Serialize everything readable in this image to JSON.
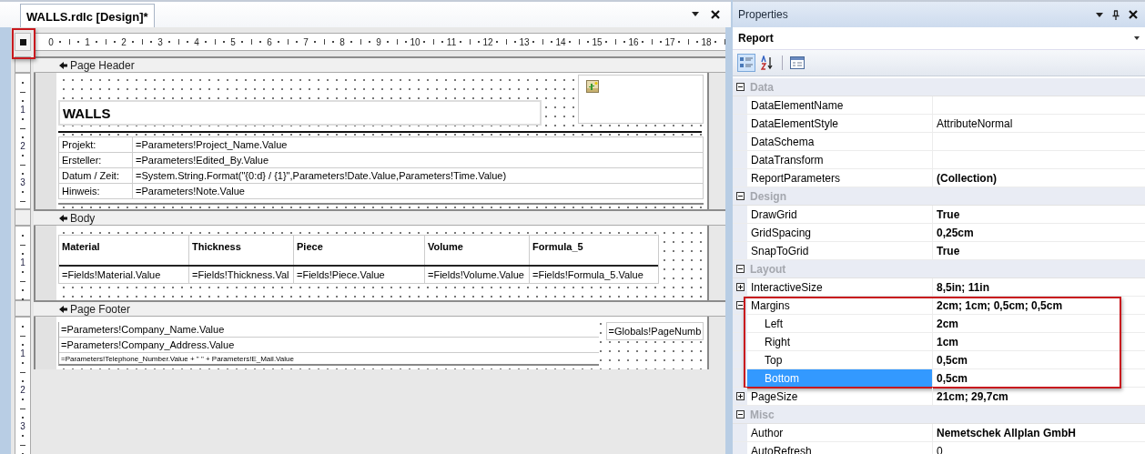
{
  "designer": {
    "tab": {
      "title": "WALLS.rdlc [Design]*",
      "selected": true
    },
    "ruler": {
      "corner_highlighted": true,
      "labels": [
        "0",
        "1",
        "2",
        "3",
        "4",
        "5",
        "6",
        "7",
        "8",
        "9",
        "10",
        "11",
        "12",
        "13",
        "14",
        "15",
        "16",
        "17",
        "18"
      ]
    },
    "sections": [
      {
        "kind": "header",
        "title": "Page Header",
        "ruler_labels": [
          "1",
          "2",
          "3"
        ],
        "title_box": "WALLS",
        "fields": [
          {
            "label": "Projekt:",
            "value": "=Parameters!Project_Name.Value"
          },
          {
            "label": "Ersteller:",
            "value": "=Parameters!Edited_By.Value"
          },
          {
            "label": "Datum / Zeit:",
            "value": "=System.String.Format(\"{0:d}  /  {1}\",Parameters!Date.Value,Parameters!Time.Value)"
          },
          {
            "label": "Hinweis:",
            "value": "=Parameters!Note.Value"
          }
        ]
      },
      {
        "kind": "body",
        "title": "Body",
        "ruler_labels": [
          "1"
        ],
        "columns": [
          "Material",
          "Thickness",
          "Piece",
          "Volume",
          "Formula_5"
        ],
        "cells": [
          "=Fields!Material.Value",
          "=Fields!Thickness.Val",
          "=Fields!Piece.Value",
          "=Fields!Volume.Value",
          "=Fields!Formula_5.Value"
        ]
      },
      {
        "kind": "footer",
        "title": "Page Footer",
        "ruler_labels": [
          "1",
          "2",
          "3"
        ],
        "lines": [
          {
            "text": "=Parameters!Company_Name.Value",
            "small": false
          },
          {
            "text": "=Parameters!Company_Address.Value",
            "small": false
          },
          {
            "text": "=Parameters!Telephone_Number.Value + \"  \" + Parameters!E_Mail.Value",
            "small": true
          }
        ],
        "page_number": "=Globals!PageNumb"
      }
    ]
  },
  "properties": {
    "title": "Properties",
    "object": "Report",
    "toolbar": [
      {
        "kind": "categorized",
        "selected": true
      },
      {
        "kind": "alphabetical",
        "selected": false
      },
      {
        "kind": "pages",
        "selected": false
      }
    ],
    "categories": [
      {
        "name": "Data",
        "expanded": true,
        "items": [
          {
            "kind": "plain",
            "name": "DataElementName",
            "selected": false
          },
          {
            "kind": "plain",
            "name": "DataElementStyle",
            "value": "AttributeNormal",
            "non_default": false,
            "selected": false
          },
          {
            "kind": "plain",
            "name": "DataSchema",
            "selected": false
          },
          {
            "kind": "plain",
            "name": "DataTransform",
            "selected": false
          },
          {
            "kind": "plain",
            "name": "ReportParameters",
            "value": "(Collection)",
            "non_default": true,
            "selected": false
          }
        ]
      },
      {
        "name": "Design",
        "expanded": true,
        "items": [
          {
            "kind": "plain",
            "name": "DrawGrid",
            "value": "True",
            "non_default": true,
            "selected": false
          },
          {
            "kind": "plain",
            "name": "GridSpacing",
            "value": "0,25cm",
            "non_default": true,
            "selected": false
          },
          {
            "kind": "plain",
            "name": "SnapToGrid",
            "value": "True",
            "non_default": true,
            "selected": false
          }
        ]
      },
      {
        "name": "Layout",
        "expanded": true,
        "items": [
          {
            "kind": "group",
            "name": "InteractiveSize",
            "value": "8,5in; 11in",
            "non_default": true,
            "selected": false,
            "expanded": false,
            "highlighted": false
          },
          {
            "kind": "group",
            "name": "Margins",
            "value": "2cm; 1cm; 0,5cm; 0,5cm",
            "non_default": true,
            "selected": false,
            "expanded": true,
            "highlighted": true,
            "children": [
              {
                "name": "Left",
                "value": "2cm",
                "non_default": true,
                "selected": false
              },
              {
                "name": "Right",
                "value": "1cm",
                "non_default": true,
                "selected": false
              },
              {
                "name": "Top",
                "value": "0,5cm",
                "non_default": true,
                "selected": false
              },
              {
                "name": "Bottom",
                "value": "0,5cm",
                "non_default": true,
                "selected": true
              }
            ]
          },
          {
            "kind": "group",
            "name": "PageSize",
            "value": "21cm; 29,7cm",
            "non_default": true,
            "selected": false,
            "expanded": false,
            "highlighted": false
          }
        ]
      },
      {
        "name": "Misc",
        "expanded": true,
        "items": [
          {
            "kind": "plain",
            "name": "Author",
            "value": "Nemetschek Allplan GmbH",
            "non_default": true,
            "selected": false
          },
          {
            "kind": "plain",
            "name": "AutoRefresh",
            "value": "0",
            "non_default": false,
            "selected": false
          }
        ]
      }
    ]
  }
}
